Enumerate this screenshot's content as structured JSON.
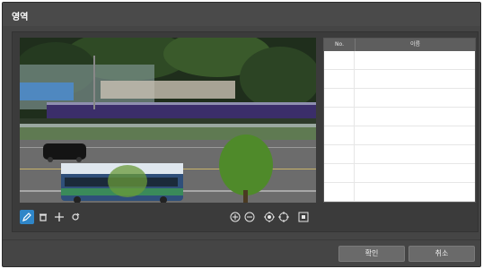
{
  "window": {
    "title": "영역"
  },
  "list": {
    "columns": {
      "no": "No.",
      "name": "이름"
    },
    "rows": [
      {
        "no": "",
        "name": ""
      },
      {
        "no": "",
        "name": ""
      },
      {
        "no": "",
        "name": ""
      },
      {
        "no": "",
        "name": ""
      },
      {
        "no": "",
        "name": ""
      },
      {
        "no": "",
        "name": ""
      },
      {
        "no": "",
        "name": ""
      },
      {
        "no": "",
        "name": ""
      }
    ]
  },
  "toolbar": {
    "tools": [
      {
        "icon": "pencil-draw-icon",
        "active": true
      },
      {
        "icon": "trash-icon",
        "active": false
      },
      {
        "icon": "move-icon",
        "active": false
      },
      {
        "icon": "edit-point-icon",
        "active": false
      }
    ],
    "zoom": [
      {
        "icon": "zoom-in-icon"
      },
      {
        "icon": "zoom-out-icon"
      },
      {
        "icon": "ptz-target-icon"
      },
      {
        "icon": "ptz-center-icon"
      },
      {
        "icon": "fit-screen-icon"
      }
    ]
  },
  "footer": {
    "confirm_label": "확인",
    "cancel_label": "취소"
  },
  "colors": {
    "accent": "#2f86c8",
    "dialog_bg": "#454545",
    "panel_bg": "#3b3b3b"
  }
}
